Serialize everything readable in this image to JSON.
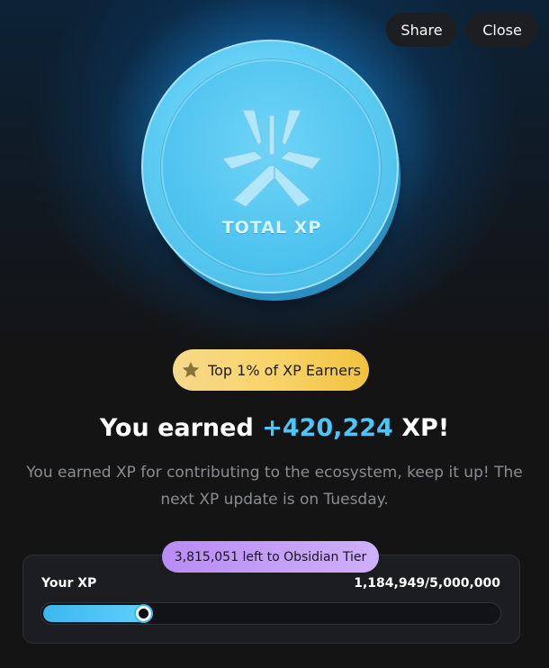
{
  "header": {
    "share_label": "Share",
    "close_label": "Close"
  },
  "coin": {
    "label": "TOTAL XP",
    "icon": "xp-logo-icon",
    "color": "#5fcdf3"
  },
  "badge": {
    "text": "Top 1% of XP Earners",
    "icon": "star-icon",
    "color": "#f8d46a"
  },
  "headline": {
    "prefix": "You earned ",
    "amount": "+420,224",
    "suffix": " XP!",
    "amount_color": "#4ec5f7"
  },
  "description": {
    "line1": "You earned XP for contributing to the ecosystem, keep it up! The",
    "line2": "next XP update is on Tuesday."
  },
  "progress": {
    "tier_pill": "3,815,051 left to Obsidian Tier",
    "label": "Your XP",
    "values_text": "1,184,949/5,000,000",
    "current": 1184949,
    "max": 5000000,
    "fill_color": "#3bb8ef",
    "pill_color": "#b88cf4"
  }
}
